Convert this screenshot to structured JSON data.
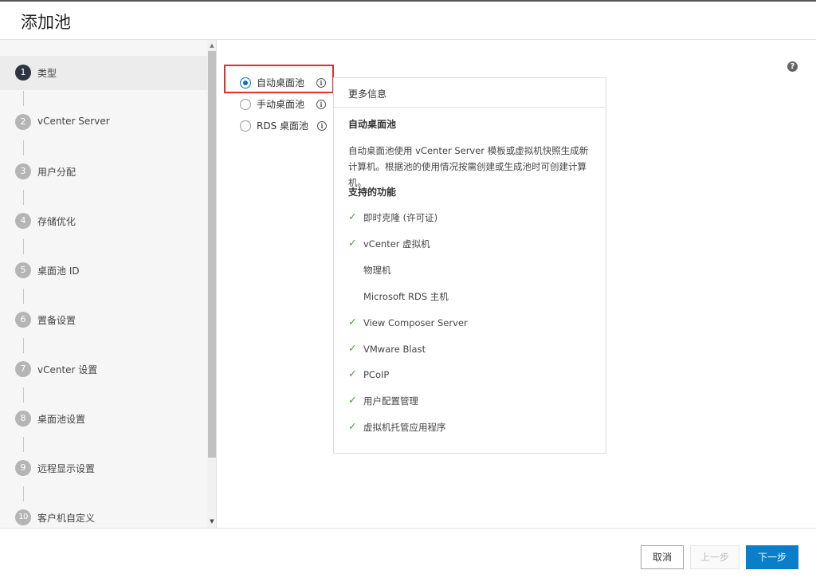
{
  "header": {
    "title": "添加池"
  },
  "sidebar": {
    "steps": [
      {
        "num": "1",
        "label": "类型"
      },
      {
        "num": "2",
        "label": "vCenter Server"
      },
      {
        "num": "3",
        "label": "用户分配"
      },
      {
        "num": "4",
        "label": "存储优化"
      },
      {
        "num": "5",
        "label": "桌面池 ID"
      },
      {
        "num": "6",
        "label": "置备设置"
      },
      {
        "num": "7",
        "label": "vCenter 设置"
      },
      {
        "num": "8",
        "label": "桌面池设置"
      },
      {
        "num": "9",
        "label": "远程显示设置"
      },
      {
        "num": "10",
        "label": "客户机自定义"
      }
    ],
    "active_step": "1"
  },
  "pool_types": [
    {
      "label": "自动桌面池",
      "selected": true
    },
    {
      "label": "手动桌面池",
      "selected": false
    },
    {
      "label": "RDS 桌面池",
      "selected": false
    }
  ],
  "info_panel": {
    "header": "更多信息",
    "subtitle": "自动桌面池",
    "description": "自动桌面池使用 vCenter Server 模板或虚拟机快照生成新计算机。根据池的使用情况按需创建或生成池时可创建计算机。",
    "features_title": "支持的功能",
    "features": [
      {
        "label": "即时克隆 (许可证)",
        "supported": true
      },
      {
        "label": "vCenter 虚拟机",
        "supported": true
      },
      {
        "label": "物理机",
        "supported": false
      },
      {
        "label": "Microsoft RDS 主机",
        "supported": false
      },
      {
        "label": "View Composer Server",
        "supported": true
      },
      {
        "label": "VMware Blast",
        "supported": true
      },
      {
        "label": "PCoIP",
        "supported": true
      },
      {
        "label": "用户配置管理",
        "supported": true
      },
      {
        "label": "虚拟机托管应用程序",
        "supported": true
      }
    ]
  },
  "footer": {
    "cancel_label": "取消",
    "prev_label": "上一步",
    "next_label": "下一步"
  },
  "icons": {
    "help": "help-icon",
    "info": "info-icon",
    "check": "check-icon"
  },
  "colors": {
    "primary": "#0a7fc9",
    "check": "#48a23f",
    "highlight": "#e03030",
    "active_step": "#2d3640"
  }
}
